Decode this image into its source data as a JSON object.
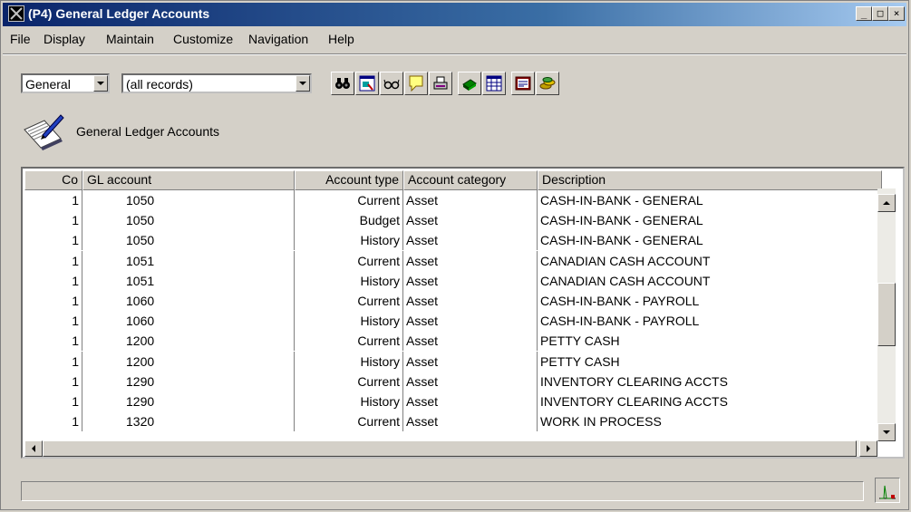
{
  "window": {
    "title": "(P4) General Ledger Accounts",
    "minimize_glyph": "_",
    "maximize_glyph": "□",
    "close_glyph": "×"
  },
  "menu": [
    "File",
    "Display",
    "Maintain",
    "Customize",
    "Navigation",
    "Help"
  ],
  "toolbar": {
    "view_select": "General",
    "filter_select": "(all records)",
    "icons": [
      "binoculars-icon",
      "form-search-icon",
      "glasses-icon",
      "note-icon",
      "print-icon",
      "green-book-icon",
      "spreadsheet-icon",
      "report-icon",
      "coins-icon"
    ]
  },
  "header": {
    "title": "General Ledger Accounts",
    "icon": "document-pen-icon"
  },
  "table": {
    "columns": [
      "Co",
      "GL account",
      "Account type",
      "Account category",
      "Description"
    ],
    "rows": [
      [
        "1",
        "1050",
        "Current",
        "Asset",
        "CASH-IN-BANK - GENERAL"
      ],
      [
        "1",
        "1050",
        "Budget",
        "Asset",
        "CASH-IN-BANK - GENERAL"
      ],
      [
        "1",
        "1050",
        "History",
        "Asset",
        "CASH-IN-BANK - GENERAL"
      ],
      [
        "1",
        "1051",
        "Current",
        "Asset",
        "CANADIAN CASH ACCOUNT"
      ],
      [
        "1",
        "1051",
        "History",
        "Asset",
        "CANADIAN CASH ACCOUNT"
      ],
      [
        "1",
        "1060",
        "Current",
        "Asset",
        "CASH-IN-BANK - PAYROLL"
      ],
      [
        "1",
        "1060",
        "History",
        "Asset",
        "CASH-IN-BANK - PAYROLL"
      ],
      [
        "1",
        "1200",
        "Current",
        "Asset",
        "PETTY CASH"
      ],
      [
        "1",
        "1200",
        "History",
        "Asset",
        "PETTY CASH"
      ],
      [
        "1",
        "1290",
        "Current",
        "Asset",
        "INVENTORY CLEARING ACCTS"
      ],
      [
        "1",
        "1290",
        "History",
        "Asset",
        "INVENTORY CLEARING ACCTS"
      ],
      [
        "1",
        "1320",
        "Current",
        "Asset",
        "WORK IN PROCESS"
      ]
    ]
  },
  "status": {
    "text": "",
    "icon": "chart-icon"
  },
  "colors": {
    "titlebar_start": "#0a246a",
    "titlebar_end": "#a6caf0",
    "face": "#d4d0c8"
  }
}
